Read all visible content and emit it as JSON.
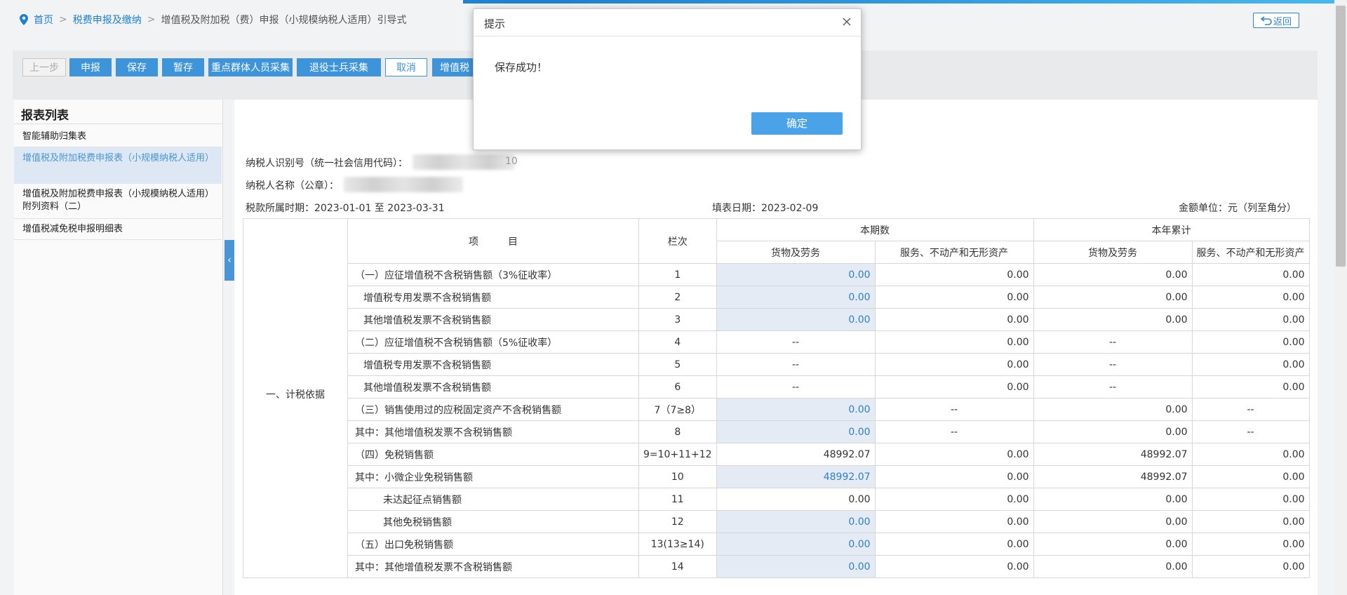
{
  "breadcrumb": {
    "home": "首页",
    "level1": "税费申报及缴纳",
    "current": "增值税及附加税（费）申报（小规模纳税人适用）引导式"
  },
  "back_label": "返回",
  "toolbar": {
    "prev": "上一步",
    "declare": "申报",
    "save": "保存",
    "temp_save": "暂存",
    "key_group": "重点群体人员采集",
    "veteran": "退役士兵采集",
    "cancel": "取消",
    "vat_partial": "增值税"
  },
  "sidebar": {
    "title": "报表列表",
    "items": [
      {
        "label": "智能辅助归集表"
      },
      {
        "label": "增值税及附加税费申报表（小规模纳税人适用）"
      },
      {
        "label": "增值税及附加税费申报表（小规模纳税人适用）附列资料（二）"
      },
      {
        "label": "增值税减免税申报明细表"
      }
    ]
  },
  "form": {
    "taxpayer_id_label": "纳税人识别号（统一社会信用代码）：",
    "taxpayer_id_tail": "10",
    "taxpayer_name_label": "纳税人名称（公章）：",
    "period": "税款所属时期：2023-01-01 至 2023-03-31",
    "fill_date": "填表日期：2023-02-09",
    "unit": "金额单位：元（列至角分）"
  },
  "table": {
    "header": {
      "item": "项　　　目",
      "col": "栏次",
      "current": "本期数",
      "ytd": "本年累计",
      "goods": "货物及劳务",
      "services": "服务、不动产和无形资产"
    },
    "section_label": "一、计税依据",
    "rows": [
      {
        "label": "（一）应征增值税不含税销售额（3%征收率）",
        "col": "1",
        "cur_goods": "0.00",
        "cur_serv": "0.00",
        "ytd_goods": "0.00",
        "ytd_serv": "0.00"
      },
      {
        "label": "增值税专用发票不含税销售额",
        "col": "2",
        "cur_goods": "0.00",
        "cur_serv": "0.00",
        "ytd_goods": "0.00",
        "ytd_serv": "0.00"
      },
      {
        "label": "其他增值税发票不含税销售额",
        "col": "3",
        "cur_goods": "0.00",
        "cur_serv": "0.00",
        "ytd_goods": "0.00",
        "ytd_serv": "0.00"
      },
      {
        "label": "（二）应征增值税不含税销售额（5%征收率）",
        "col": "4",
        "cur_goods": "--",
        "cur_serv": "0.00",
        "ytd_goods": "--",
        "ytd_serv": "0.00"
      },
      {
        "label": "增值税专用发票不含税销售额",
        "col": "5",
        "cur_goods": "--",
        "cur_serv": "0.00",
        "ytd_goods": "--",
        "ytd_serv": "0.00"
      },
      {
        "label": "其他增值税发票不含税销售额",
        "col": "6",
        "cur_goods": "--",
        "cur_serv": "0.00",
        "ytd_goods": "--",
        "ytd_serv": "0.00"
      },
      {
        "label": "（三）销售使用过的应税固定资产不含税销售额",
        "col": "7（7≥8）",
        "cur_goods": "0.00",
        "cur_serv": "--",
        "ytd_goods": "0.00",
        "ytd_serv": "--"
      },
      {
        "label": "其中：其他增值税发票不含税销售额",
        "col": "8",
        "cur_goods": "0.00",
        "cur_serv": "--",
        "ytd_goods": "0.00",
        "ytd_serv": "--"
      },
      {
        "label": "（四）免税销售额",
        "col": "9=10+11+12",
        "cur_goods": "48992.07",
        "cur_serv": "0.00",
        "ytd_goods": "48992.07",
        "ytd_serv": "0.00"
      },
      {
        "label": "其中：小微企业免税销售额",
        "col": "10",
        "cur_goods": "48992.07",
        "cur_serv": "0.00",
        "ytd_goods": "48992.07",
        "ytd_serv": "0.00"
      },
      {
        "label": "未达起征点销售额",
        "col": "11",
        "cur_goods": "0.00",
        "cur_serv": "0.00",
        "ytd_goods": "0.00",
        "ytd_serv": "0.00"
      },
      {
        "label": "其他免税销售额",
        "col": "12",
        "cur_goods": "0.00",
        "cur_serv": "0.00",
        "ytd_goods": "0.00",
        "ytd_serv": "0.00"
      },
      {
        "label": "（五）出口免税销售额",
        "col": "13(13≥14)",
        "cur_goods": "0.00",
        "cur_serv": "0.00",
        "ytd_goods": "0.00",
        "ytd_serv": "0.00"
      },
      {
        "label": "其中：其他增值税发票不含税销售额",
        "col": "14",
        "cur_goods": "0.00",
        "cur_serv": "0.00",
        "ytd_goods": "0.00",
        "ytd_serv": "0.00"
      }
    ]
  },
  "dialog": {
    "title": "提示",
    "message": "保存成功！",
    "ok": "确定"
  },
  "colors": {
    "primary": "#3e94da",
    "link": "#1e7fd1",
    "editable_bg": "#e4ebf4"
  }
}
